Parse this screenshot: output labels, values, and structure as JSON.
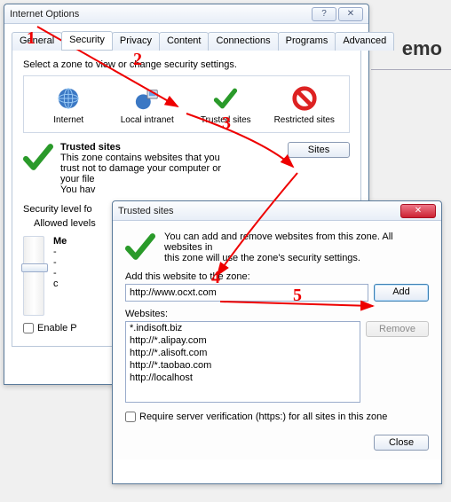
{
  "bg": {
    "text": "emo"
  },
  "io": {
    "title": "Internet Options",
    "tabs": {
      "general": "General",
      "security": "Security",
      "privacy": "Privacy",
      "content": "Content",
      "connections": "Connections",
      "programs": "Programs",
      "advanced": "Advanced"
    },
    "zone_prompt": "Select a zone to view or change security settings.",
    "zones": {
      "internet": "Internet",
      "intranet": "Local intranet",
      "trusted": "Trusted sites",
      "restricted": "Restricted sites"
    },
    "trusted": {
      "header": "Trusted sites",
      "desc1": "This zone contains websites that you",
      "desc2": "trust not to damage your computer or",
      "desc3": "your file",
      "desc4": "You hav",
      "sites_btn": "Sites"
    },
    "level": {
      "header": "Security level fo",
      "allowed": "Allowed levels",
      "me": "Me",
      "dash1": "-",
      "dash2": "-",
      "dash3": "-",
      "c": "c"
    },
    "enable": "Enable P"
  },
  "ts": {
    "title": "Trusted sites",
    "intro1": "You can add and remove websites from this zone. All websites in",
    "intro2": "this zone will use the zone's security settings.",
    "add_label": "Add this website to the zone:",
    "url_value": "http://www.ocxt.com",
    "add_btn": "Add",
    "websites_label": "Websites:",
    "websites": {
      "w0": "*.indisoft.biz",
      "w1": "http://*.alipay.com",
      "w2": "http://*.alisoft.com",
      "w3": "http://*.taobao.com",
      "w4": "http://localhost"
    },
    "remove_btn": "Remove",
    "require_label": "Require server verification (https:) for all sites in this zone",
    "close_btn": "Close"
  },
  "annotations": {
    "n1": "1",
    "n2": "2",
    "n3": "3",
    "n4": "4",
    "n5": "5"
  }
}
